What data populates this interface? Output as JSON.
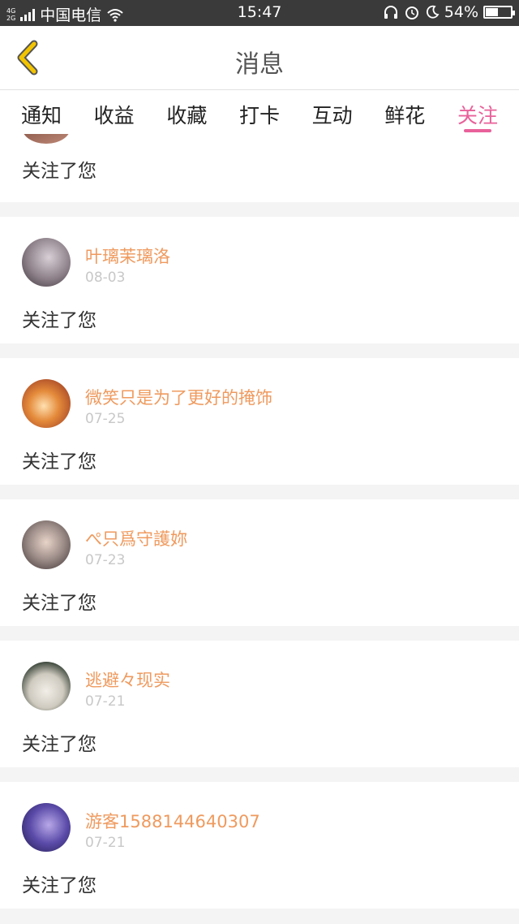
{
  "status_bar": {
    "network_top": "4G",
    "network_bottom": "2G",
    "carrier": "中国电信",
    "time": "15:47",
    "battery": "54%",
    "battery_level": 0.54,
    "icons": [
      "signal-icon",
      "wifi-icon",
      "headset-icon",
      "alarm-icon",
      "moon-icon",
      "battery-icon"
    ]
  },
  "header": {
    "title": "消息",
    "back_icon": "chevron-left-icon",
    "back_color": "#f2c400"
  },
  "tabs": [
    {
      "label": "通知",
      "active": false
    },
    {
      "label": "收益",
      "active": false
    },
    {
      "label": "收藏",
      "active": false
    },
    {
      "label": "打卡",
      "active": false
    },
    {
      "label": "互动",
      "active": false
    },
    {
      "label": "鲜花",
      "active": false
    },
    {
      "label": "关注",
      "active": true
    }
  ],
  "colors": {
    "accent": "#e8619a",
    "username": "#ef9a5e",
    "date": "#c8c8c8"
  },
  "notifications": [
    {
      "text": "关注了您"
    },
    {
      "name": "叶璃茉璃洛",
      "date": "08-03",
      "text": "关注了您"
    },
    {
      "name": "微笑只是为了更好的掩饰",
      "date": "07-25",
      "text": "关注了您"
    },
    {
      "name": "ぺ只爲守護妳",
      "date": "07-23",
      "text": "关注了您"
    },
    {
      "name": "逃避々现实",
      "date": "07-21",
      "text": "关注了您"
    },
    {
      "name": "游客1588144640307",
      "date": "07-21",
      "text": "关注了您"
    }
  ]
}
